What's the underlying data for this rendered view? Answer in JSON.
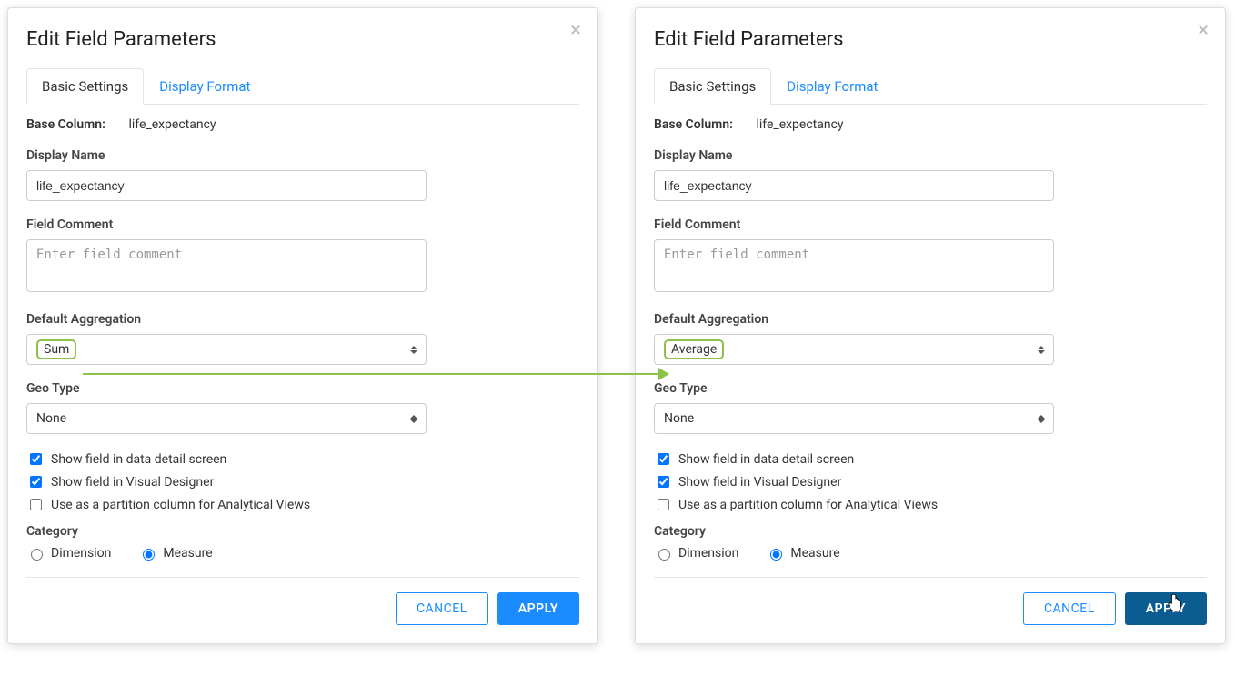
{
  "dialog_title": "Edit Field Parameters",
  "tabs": {
    "basic": "Basic Settings",
    "display": "Display Format"
  },
  "labels": {
    "base_column": "Base Column:",
    "display_name": "Display Name",
    "field_comment": "Field Comment",
    "default_aggregation": "Default Aggregation",
    "geo_type": "Geo Type",
    "category": "Category"
  },
  "base_column_value": "life_expectancy",
  "display_name_value": "life_expectancy",
  "field_comment_placeholder": "Enter field comment",
  "aggregation": {
    "left": "Sum",
    "right": "Average"
  },
  "geo_type_value": "None",
  "checks": {
    "show_detail": "Show field in data detail screen",
    "show_designer": "Show field in Visual Designer",
    "partition": "Use as a partition column for Analytical Views"
  },
  "category_options": {
    "dimension": "Dimension",
    "measure": "Measure"
  },
  "buttons": {
    "cancel": "CANCEL",
    "apply": "APPLY"
  }
}
